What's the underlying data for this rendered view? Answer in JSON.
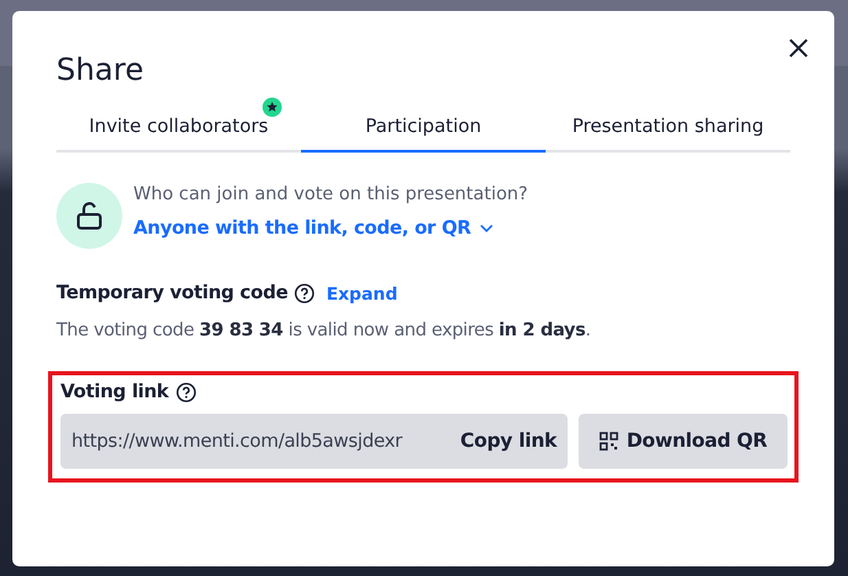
{
  "dialog": {
    "title": "Share"
  },
  "tabs": [
    {
      "label": "Invite collaborators",
      "selected": false,
      "badge": true
    },
    {
      "label": "Participation",
      "selected": true,
      "badge": false
    },
    {
      "label": "Presentation sharing",
      "selected": false,
      "badge": false
    }
  ],
  "access": {
    "question": "Who can join and vote on this presentation?",
    "option": "Anyone with the link, code, or QR"
  },
  "voting_code": {
    "heading": "Temporary voting code",
    "expand_link": "Expand",
    "description": "The voting code **39 83 34** is valid now and expires **in 2 days**."
  },
  "voting_link": {
    "heading": "Voting link",
    "highlighted": true,
    "url": "https://www.menti.com/alb5awsjdexr",
    "copy_button": "Copy link",
    "qr_button": "Download QR"
  }
}
